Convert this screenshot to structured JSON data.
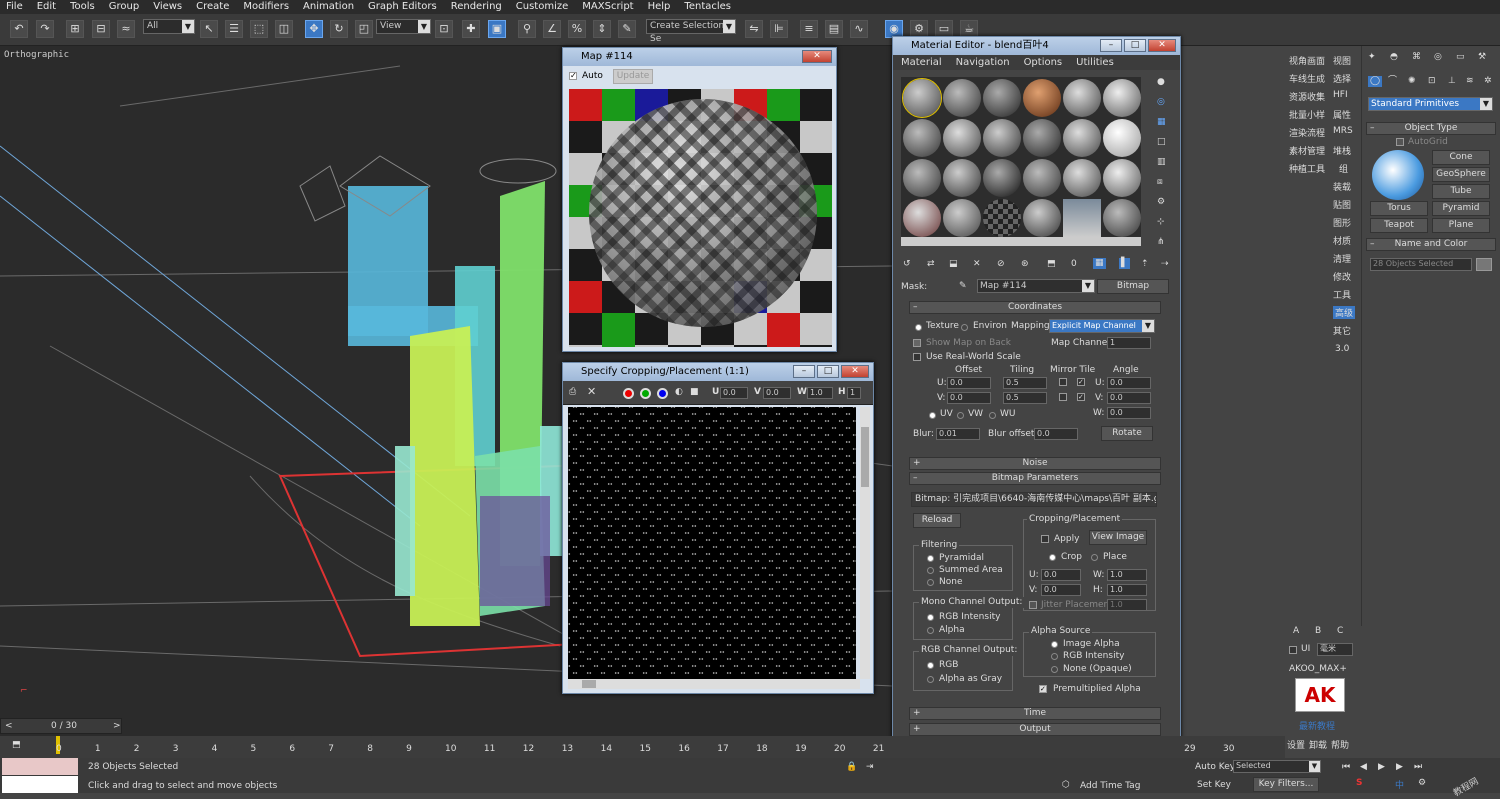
{
  "menu": [
    "File",
    "Edit",
    "Tools",
    "Group",
    "Views",
    "Create",
    "Modifiers",
    "Animation",
    "Graph Editors",
    "Rendering",
    "Customize",
    "MAXScript",
    "Help",
    "Tentacles"
  ],
  "toolbar": {
    "filter_value": "All",
    "refcoord_value": "View",
    "selset_placeholder": "Create Selection Se"
  },
  "viewport": {
    "label": "Orthographic"
  },
  "map_window": {
    "title": "Map #114",
    "auto_label": "Auto",
    "update_label": "Update"
  },
  "crop_window": {
    "title": "Specify Cropping/Placement (1:1)",
    "u_label": "U",
    "u_value": "0.0",
    "v_label": "V",
    "v_value": "0.0",
    "w_label": "W",
    "w_value": "1.0",
    "h_label": "H",
    "h_value": "1"
  },
  "mat_editor": {
    "title": "Material Editor -   blend百叶4",
    "menus": [
      "Material",
      "Navigation",
      "Options",
      "Utilities"
    ],
    "mask_label": "Mask:",
    "map_name": "Map #114",
    "map_type": "Bitmap",
    "coordinates": {
      "header": "Coordinates",
      "texture": "Texture",
      "environ": "Environ",
      "mapping_label": "Mapping:",
      "mapping_value": "Explicit Map Channel",
      "show_map_back": "Show Map on Back",
      "map_channel_label": "Map Channel:",
      "map_channel_value": "1",
      "real_world": "Use Real-World Scale",
      "offset": "Offset",
      "tiling": "Tiling",
      "mirror_tile": "Mirror Tile",
      "angle": "Angle",
      "u": "U:",
      "v": "V:",
      "w": "W:",
      "u_offset": "0.0",
      "v_offset": "0.0",
      "u_tiling": "0.5",
      "v_tiling": "0.5",
      "u_angle": "0.0",
      "v_angle": "0.0",
      "w_angle": "0.0",
      "uv": "UV",
      "vw": "VW",
      "wu": "WU",
      "blur_label": "Blur:",
      "blur_value": "0.01",
      "blur_offset_label": "Blur offset:",
      "blur_offset_value": "0.0",
      "rotate": "Rotate"
    },
    "noise": "Noise",
    "bitmap_params": {
      "header": "Bitmap Parameters",
      "bitmap_path": "Bitmap: 引完成项目\\6640-海南传媒中心\\maps\\百叶 副本.gif",
      "reload": "Reload",
      "cropping": "Cropping/Placement",
      "apply": "Apply",
      "view_image": "View Image",
      "crop": "Crop",
      "place": "Place",
      "cu": "U:",
      "cu_value": "0.0",
      "cw": "W:",
      "cw_value": "1.0",
      "cv": "V:",
      "cv_value": "0.0",
      "ch": "H:",
      "ch_value": "1.0",
      "jitter": "Jitter Placement",
      "jitter_value": "1.0",
      "filtering": "Filtering",
      "pyramidal": "Pyramidal",
      "summed": "Summed Area",
      "none": "None",
      "mono": "Mono Channel Output:",
      "rgb_int": "RGB Intensity",
      "alpha": "Alpha",
      "rgb_out": "RGB Channel Output:",
      "rgb": "RGB",
      "alpha_gray": "Alpha as Gray",
      "alpha_src": "Alpha Source",
      "image_alpha": "Image Alpha",
      "rgb_int2": "RGB Intensity",
      "none_opaque": "None (Opaque)",
      "premult": "Premultiplied Alpha"
    },
    "time": "Time",
    "output": "Output"
  },
  "cjk_menu": [
    "视角画面",
    "车线生成",
    "资源收集",
    "批量小样",
    "渲染流程",
    "素材管理",
    "种植工具"
  ],
  "cjk_col2": [
    "视图",
    "选择",
    "HFI",
    "属性",
    "MRS",
    "堆栈",
    "组",
    "装载",
    "贴图",
    "图形",
    "材质",
    "清理",
    "修改",
    "工具",
    "高级",
    "其它",
    "3.0"
  ],
  "cmd_panel": {
    "primitives": "Standard Primitives",
    "object_type": "Object Type",
    "autogrid": "AutoGrid",
    "objects": [
      "Cone",
      "GeoSphere",
      "Tube",
      "Pyramid",
      "Plane"
    ],
    "left_objects": [
      "Torus",
      "Teapot"
    ],
    "name_color": "Name and Color",
    "name_value": "28 Objects Selected"
  },
  "abc": [
    "A",
    "B",
    "C"
  ],
  "ui_label": "UI",
  "unit_value": "毫米",
  "akoo": "AKOO_MAX+",
  "logo_text": "AK",
  "logo_caption": "最新教程",
  "bottom_cjk": [
    "设置",
    "卸载",
    "帮助"
  ],
  "timeline": {
    "frame": "0 / 30",
    "ticks": [
      "0",
      "1",
      "2",
      "3",
      "4",
      "5",
      "6",
      "7",
      "8",
      "9",
      "10",
      "11",
      "12",
      "13",
      "14",
      "15",
      "16",
      "17",
      "18",
      "19",
      "20",
      "21",
      "29",
      "30"
    ]
  },
  "status": {
    "selected": "28 Objects Selected",
    "prompt": "Click and drag to select and move objects",
    "add_time_tag": "Add Time Tag",
    "auto_key": "Auto Key",
    "set_key": "Set Key",
    "selected_dd": "Selected",
    "key_filters": "Key Filters..."
  },
  "watermark": "教程网",
  "colors": {
    "accent": "#3b78c4",
    "viewport_bg": "#2b2b2b",
    "panel": "#444444"
  }
}
